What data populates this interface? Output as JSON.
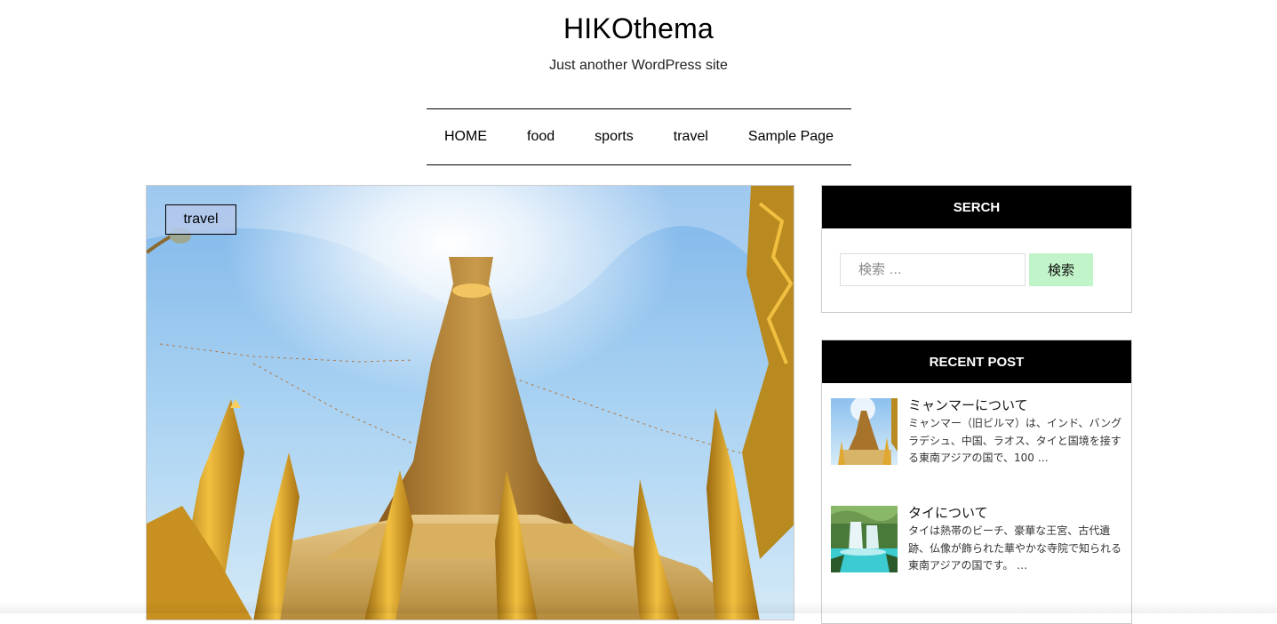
{
  "header": {
    "site_title": "HIKOthema",
    "site_description": "Just another WordPress site"
  },
  "nav": {
    "items": [
      {
        "label": "HOME"
      },
      {
        "label": "food"
      },
      {
        "label": "sports"
      },
      {
        "label": "travel"
      },
      {
        "label": "Sample Page"
      }
    ]
  },
  "featured_post": {
    "category": "travel",
    "image": "golden-pagoda-photo"
  },
  "sidebar": {
    "search": {
      "heading": "SERCH",
      "placeholder": "検索 …",
      "button_label": "検索"
    },
    "recent": {
      "heading": "RECENT POST",
      "posts": [
        {
          "title": "ミャンマーについて",
          "excerpt": "ミャンマー（旧ビルマ）は、インド、バングラデシュ、中国、ラオス、タイと国境を接する東南アジアの国で、100 …",
          "thumb": "pagoda-thumbnail"
        },
        {
          "title": "タイについて",
          "excerpt": "タイは熱帯のビーチ、豪華な王宮、古代遺跡、仏像が飾られた華やかな寺院で知られる東南アジアの国です。 …",
          "thumb": "waterfall-thumbnail"
        }
      ]
    }
  },
  "colors": {
    "widget_header_bg": "#000000",
    "search_button_bg": "#c1f5c9",
    "category_badge_bg": "#b4c8eb"
  }
}
